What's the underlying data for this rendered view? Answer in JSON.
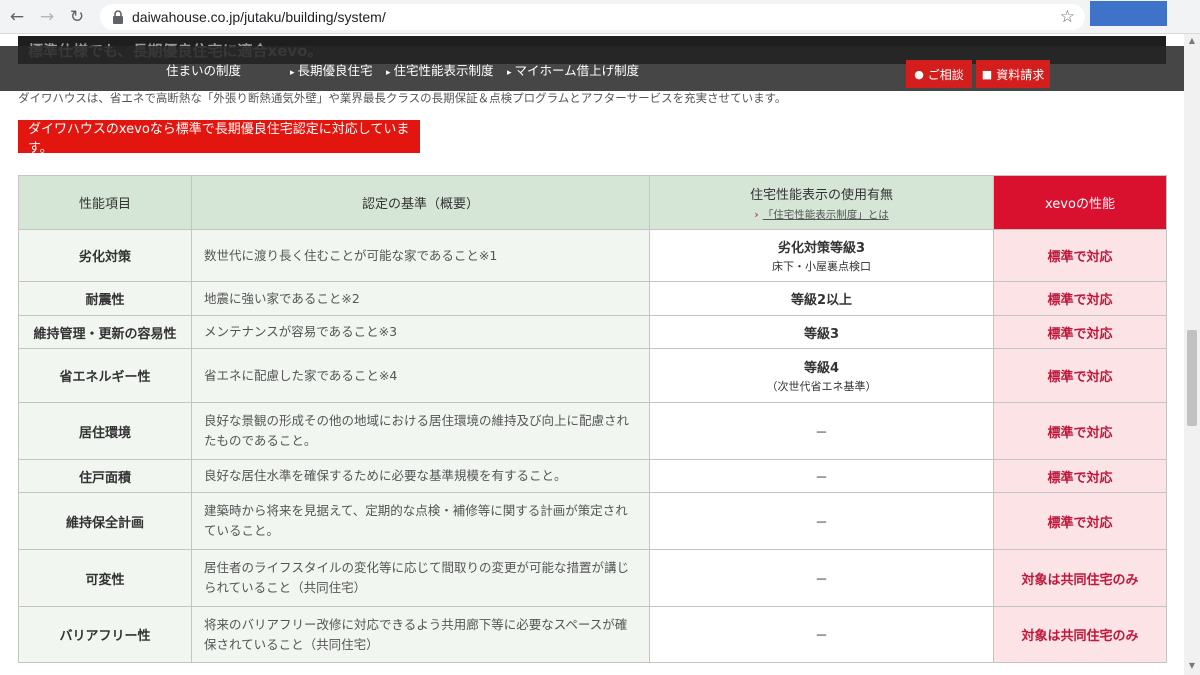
{
  "browser": {
    "back_glyph": "←",
    "forward_glyph": "→",
    "reload_glyph": "↻",
    "url": "daiwahouse.co.jp/jutaku/building/system/",
    "bookmark_glyph": "☆",
    "icons": {
      "back": "arrow-left-icon",
      "forward": "arrow-right-icon",
      "reload": "reload-icon",
      "lock": "lock-icon",
      "bookmark": "star-icon"
    }
  },
  "page": {
    "behind_heading": "標準仕様でも、長期優良住宅に適合xevo。",
    "nav": {
      "items": [
        {
          "label": "住まいの制度",
          "arrow": ""
        },
        {
          "label": "長期優良住宅",
          "arrow": "▸"
        },
        {
          "label": "住宅性能表示制度",
          "arrow": "▸"
        },
        {
          "label": "マイホーム借上げ制度",
          "arrow": "▸"
        }
      ],
      "consult": {
        "label": "ご相談",
        "icon": "speech-bubble-icon",
        "glyph": "●"
      },
      "catalog": {
        "label": "資料請求",
        "icon": "document-icon",
        "glyph": "■"
      }
    },
    "intro_text": "ダイワハウスは、省エネで高断熱な「外張り断熱通気外壁」や業界最長クラスの長期保証＆点検プログラムとアフターサービスを充実させています。",
    "banner": "ダイワハウスのxevoなら標準で長期優良住宅認定に対応しています。",
    "table": {
      "headers": {
        "item": "性能項目",
        "criteria": "認定の基準（概要）",
        "usage": "住宅性能表示の使用有無",
        "usage_link": "「住宅性能表示制度」とは",
        "usage_link_glyph": "›",
        "xevo": "xevoの性能"
      },
      "rows": [
        {
          "item": "劣化対策",
          "criteria": "数世代に渡り長く住むことが可能な家であること※1",
          "usage": "劣化対策等級3",
          "usage_sub": "床下・小屋裏点検口",
          "xevo": "標準で対応"
        },
        {
          "item": "耐震性",
          "criteria": "地震に強い家であること※2",
          "usage": "等級2以上",
          "usage_sub": "",
          "xevo": "標準で対応"
        },
        {
          "item": "維持管理・更新の容易性",
          "criteria": "メンテナンスが容易であること※3",
          "usage": "等級3",
          "usage_sub": "",
          "xevo": "標準で対応"
        },
        {
          "item": "省エネルギー性",
          "criteria": "省エネに配慮した家であること※4",
          "usage": "等級4",
          "usage_sub": "（次世代省エネ基準）",
          "xevo": "標準で対応"
        },
        {
          "item": "居住環境",
          "criteria": "良好な景観の形成その他の地域における居住環境の維持及び向上に配慮されたものであること。",
          "usage": "－",
          "usage_sub": "",
          "xevo": "標準で対応"
        },
        {
          "item": "住戸面積",
          "criteria": "良好な居住水準を確保するために必要な基準規模を有すること。",
          "usage": "－",
          "usage_sub": "",
          "xevo": "標準で対応"
        },
        {
          "item": "維持保全計画",
          "criteria": "建築時から将来を見据えて、定期的な点検・補修等に関する計画が策定されていること。",
          "usage": "－",
          "usage_sub": "",
          "xevo": "標準で対応"
        },
        {
          "item": "可変性",
          "criteria": "居住者のライフスタイルの変化等に応じて間取りの変更が可能な措置が講じられていること（共同住宅）",
          "usage": "－",
          "usage_sub": "",
          "xevo": "対象は共同住宅のみ"
        },
        {
          "item": "バリアフリー性",
          "criteria": "将来のバリアフリー改修に対応できるよう共用廊下等に必要なスペースが確保されていること（共同住宅）",
          "usage": "－",
          "usage_sub": "",
          "xevo": "対象は共同住宅のみ"
        }
      ]
    }
  }
}
